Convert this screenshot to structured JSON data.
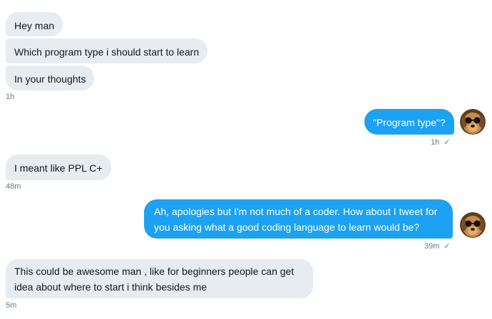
{
  "messages": [
    {
      "text": "Hey man"
    },
    {
      "text": "Which program type i should start to learn"
    },
    {
      "text": "In your thoughts"
    },
    {
      "text": "\"Program type\"?"
    },
    {
      "text": "I meant like PPL C+"
    },
    {
      "text": "Ah, apologies but I'm not much of a coder. How about I tweet for you asking what a good coding language to learn would be?"
    },
    {
      "text": "This could be awesome man , like for beginners people can get idea about where to start i think besides me"
    }
  ],
  "timestamps": {
    "t1": "1h",
    "t2": "1h",
    "t3": "48m",
    "t4": "39m",
    "t5": "5m"
  },
  "read_check": "✓",
  "colors": {
    "sent_bubble": "#1da1f2",
    "received_bubble": "#e6ecf0",
    "meta_text": "#657786"
  },
  "icons": {
    "avatar": "dog-with-sunglasses-avatar",
    "read_receipt": "check-icon"
  }
}
